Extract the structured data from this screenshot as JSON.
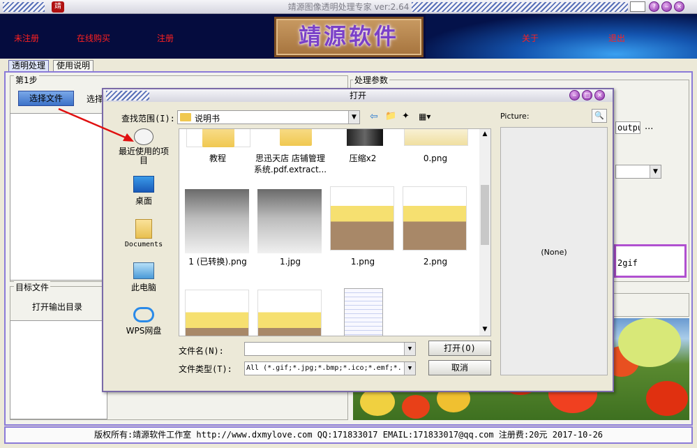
{
  "window": {
    "title": "靖源图像透明处理专家 ver:2.64",
    "app_icon": "app-logo-icon"
  },
  "banner": {
    "links": [
      "未注册",
      "在线购买",
      "注册",
      "关于",
      "退出"
    ],
    "logo_text": "靖源软件"
  },
  "tabs": [
    "透明处理",
    "使用说明"
  ],
  "left": {
    "step1": "第1步",
    "select_file_button": "选择文件",
    "select_partial": "选择",
    "target_label": "目标文件",
    "open_output_button": "打开输出目录"
  },
  "right": {
    "params_label": "处理参数",
    "output_field_partial": "outpu",
    "ellipsis": "...",
    "format_partial": "2gif"
  },
  "dialog": {
    "title": "打开",
    "look_in_label": "查找范围(I):",
    "look_in_value": "说明书",
    "places": [
      {
        "label": "最近使用的项目",
        "icon": "recent-items-icon"
      },
      {
        "label": "桌面",
        "icon": "desktop-icon"
      },
      {
        "label": "Documents",
        "icon": "documents-icon"
      },
      {
        "label": "此电脑",
        "icon": "computer-icon"
      },
      {
        "label": "WPS网盘",
        "icon": "cloud-drive-icon"
      }
    ],
    "files_row1": [
      "教程",
      "思迅天店 店铺管理系统.pdf.extract...",
      "压缩x2",
      "0.png"
    ],
    "files_row2": [
      "1 (已转换).png",
      "1.jpg",
      "1.png",
      "2.png"
    ],
    "preview_label": "Picture:",
    "preview_value": "(None)",
    "filename_label": "文件名(N):",
    "filename_value": "",
    "filetype_label": "文件类型(T):",
    "filetype_value": "All (*.gif;*.jpg;*.bmp;*.ico;*.emf;*.",
    "open_button": "打开(O)",
    "cancel_button": "取消"
  },
  "status_bar": "版权所有:靖源软件工作室 http://www.dxmylove.com QQ:171833017 EMAIL:171833017@qq.com 注册费:20元 2017-10-26",
  "colors": {
    "accent_border": "#8a7ad8",
    "banner_bg": "#050c3e",
    "link_red": "#ff2020",
    "annotation_arrow": "#e01010"
  }
}
